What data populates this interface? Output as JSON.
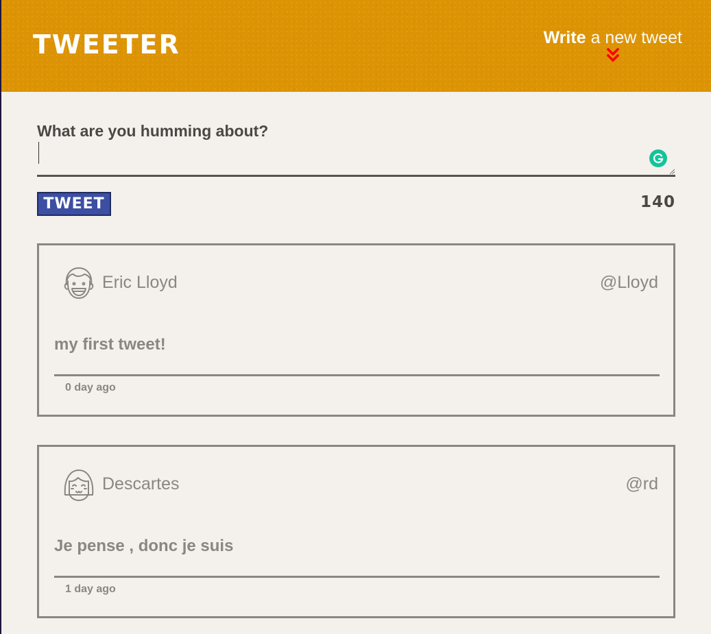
{
  "header": {
    "logo": "TWEETER",
    "compose_strong": "Write",
    "compose_light": "a new tweet",
    "chevron_icon": "double-chevron-down-icon",
    "chevron_color": "#ff0000",
    "background_color": "#dc9304"
  },
  "composer": {
    "label": "What are you humming about?",
    "value": "",
    "placeholder": "",
    "button_label": "TWEET",
    "counter": "140",
    "button_color": "#3d4fa3",
    "grammarly_icon": "grammarly-icon",
    "grammarly_color": "#15c39a"
  },
  "tweets": [
    {
      "name": "Eric Lloyd",
      "handle": "@Lloyd",
      "avatar_icon": "boy-face-avatar-icon",
      "text": "my first tweet!",
      "time": "0 day ago"
    },
    {
      "name": "Descartes",
      "handle": "@rd",
      "avatar_icon": "girl-face-avatar-icon",
      "text": "Je pense , donc je suis",
      "time": "1 day ago"
    }
  ]
}
